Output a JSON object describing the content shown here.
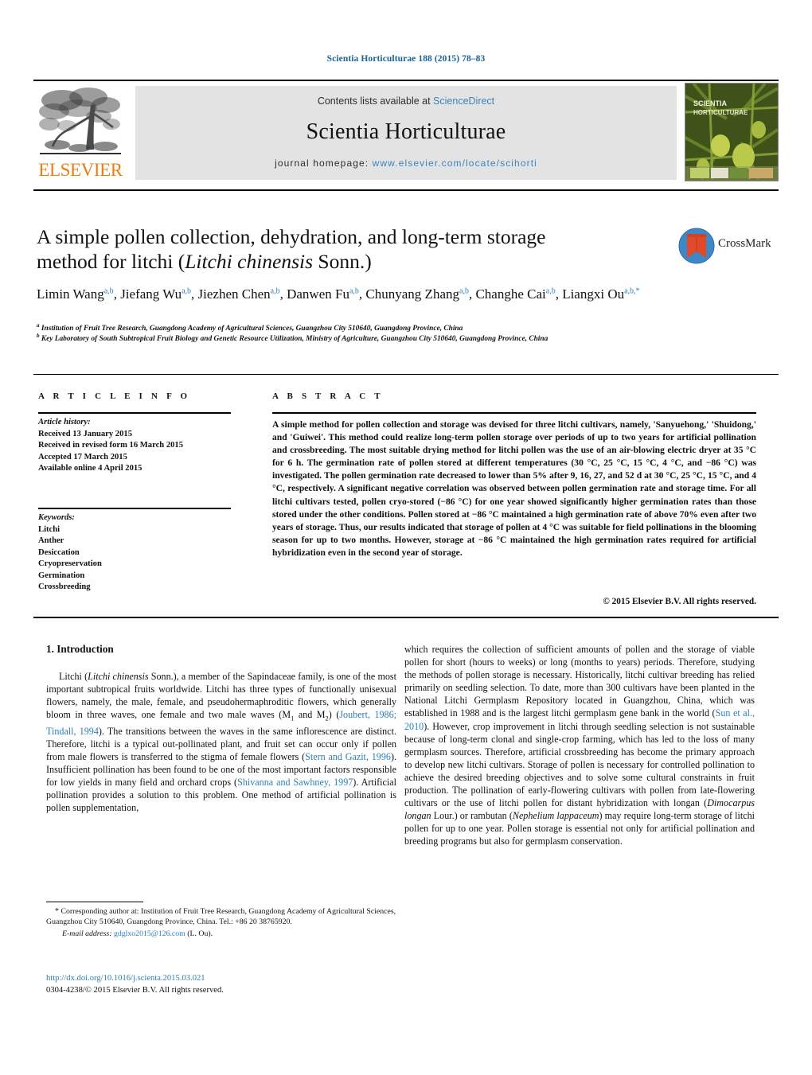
{
  "running_head": "Scientia Horticulturae 188 (2015) 78–83",
  "masthead": {
    "contents_prefix": "Contents lists available at ",
    "sciencedirect": "ScienceDirect",
    "journal_name": "Scientia Horticulturae",
    "homepage_prefix": "journal homepage: ",
    "homepage_url": "www.elsevier.com/locate/scihorti",
    "publisher_wordmark": "ELSEVIER",
    "cover_title_line1": "SCIENTIA",
    "cover_title_line2": "HORTICULTURAE",
    "accent_color": "#3a84bd",
    "elsevier_orange": "#ee7d11"
  },
  "crossmark": {
    "label": "CrossMark"
  },
  "article": {
    "title_line1": "A simple pollen collection, dehydration, and long-term storage",
    "title_line2_pre": "method for litchi (",
    "title_line2_italic": "Litchi chinensis",
    "title_line2_post": " Sonn.)",
    "authors": [
      {
        "name": "Limin Wang",
        "sup": "a,b",
        "sep": ", "
      },
      {
        "name": "Jiefang Wu",
        "sup": "a,b",
        "sep": ", "
      },
      {
        "name": "Jiezhen Chen",
        "sup": "a,b",
        "sep": ", "
      },
      {
        "name": "Danwen Fu",
        "sup": "a,b",
        "sep": ", "
      },
      {
        "name": "Chunyang Zhang",
        "sup": "a,b",
        "sep": ", "
      },
      {
        "name": "Changhe Cai",
        "sup": "a,b",
        "sep": ", "
      },
      {
        "name": "Liangxi Ou",
        "sup": "a,b,*",
        "sep": ""
      }
    ],
    "affiliations": [
      {
        "marker": "a",
        "text": "Institution of Fruit Tree Research, Guangdong Academy of Agricultural Sciences, Guangzhou City 510640, Guangdong Province, China"
      },
      {
        "marker": "b",
        "text": "Key Laboratory of South Subtropical Fruit Biology and Genetic Resource Utilization, Ministry of Agriculture, Guangzhou City 510640, Guangdong Province, China"
      }
    ]
  },
  "article_info": {
    "heading": "A R T I C L E   I N F O",
    "history_label": "Article history:",
    "history": [
      "Received 13 January 2015",
      "Received in revised form 16 March 2015",
      "Accepted 17 March 2015",
      "Available online 4 April 2015"
    ],
    "keywords_label": "Keywords:",
    "keywords": [
      "Litchi",
      "Anther",
      "Desiccation",
      "Cryopreservation",
      "Germination",
      "Crossbreeding"
    ]
  },
  "abstract": {
    "heading": "A B S T R A C T",
    "text": "A simple method for pollen collection and storage was devised for three litchi cultivars, namely, 'Sanyuehong,' 'Shuidong,' and 'Guiwei'. This method could realize long-term pollen storage over periods of up to two years for artificial pollination and crossbreeding. The most suitable drying method for litchi pollen was the use of an air-blowing electric dryer at 35 °C for 6 h. The germination rate of pollen stored at different temperatures (30 °C, 25 °C, 15 °C, 4 °C, and −86 °C) was investigated. The pollen germination rate decreased to lower than 5% after 9, 16, 27, and 52 d at 30 °C, 25 °C, 15 °C, and 4 °C, respectively. A significant negative correlation was observed between pollen germination rate and storage time. For all litchi cultivars tested, pollen cryo-stored (−86 °C) for one year showed significantly higher germination rates than those stored under the other conditions. Pollen stored at −86 °C maintained a high germination rate of above 70% even after two years of storage. Thus, our results indicated that storage of pollen at 4 °C was suitable for field pollinations in the blooming season for up to two months. However, storage at −86 °C maintained the high germination rates required for artificial hybridization even in the second year of storage.",
    "copyright": "© 2015 Elsevier B.V. All rights reserved."
  },
  "introduction": {
    "section_number_title": "1.  Introduction",
    "left_para_segments": [
      {
        "t": "Litchi (",
        "s": "plain"
      },
      {
        "t": "Litchi chinensis",
        "s": "italic"
      },
      {
        "t": " Sonn.), a member of the Sapindaceae family, is one of the most important subtropical fruits worldwide. Litchi has three types of functionally unisexual flowers, namely, the male, female, and pseudohermaphroditic flowers, which generally bloom in three waves, one female and two male waves (M",
        "s": "plain"
      },
      {
        "t": "1",
        "s": "sub"
      },
      {
        "t": " and M",
        "s": "plain"
      },
      {
        "t": "2",
        "s": "sub"
      },
      {
        "t": ") (",
        "s": "plain"
      },
      {
        "t": "Joubert, 1986; Tindall, 1994",
        "s": "ref"
      },
      {
        "t": "). The transitions between the waves in the same inflorescence are distinct. Therefore, litchi is a typical out-pollinated plant, and fruit set can occur only if pollen from male flowers is transferred to the stigma of female flowers (",
        "s": "plain"
      },
      {
        "t": "Stern and Gazit, 1996",
        "s": "ref"
      },
      {
        "t": "). Insufficient pollination has been found to be one of the most important factors responsible for low yields in many field and orchard crops (",
        "s": "plain"
      },
      {
        "t": "Shivanna and Sawhney, 1997",
        "s": "ref"
      },
      {
        "t": "). Artificial pollination provides a solution to this problem. One method of artificial pollination is pollen supplementation,",
        "s": "plain"
      }
    ],
    "right_para_segments": [
      {
        "t": "which requires the collection of sufficient amounts of pollen and the storage of viable pollen for short (hours to weeks) or long (months to years) periods. Therefore, studying the methods of pollen storage is necessary. Historically, litchi cultivar breeding has relied primarily on seedling selection. To date, more than 300 cultivars have been planted in the National Litchi Germplasm Repository located in Guangzhou, China, which was established in 1988 and is the largest litchi germplasm gene bank in the world (",
        "s": "plain"
      },
      {
        "t": "Sun et al., 2010",
        "s": "ref"
      },
      {
        "t": "). However, crop improvement in litchi through seedling selection is not sustainable because of long-term clonal and single-crop farming, which has led to the loss of many germplasm sources. Therefore, artificial crossbreeding has become the primary approach to develop new litchi cultivars. Storage of pollen is necessary for controlled pollination to achieve the desired breeding objectives and to solve some cultural constraints in fruit production. The pollination of early-flowering cultivars with pollen from late-flowering cultivars or the use of litchi pollen for distant hybridization with longan (",
        "s": "plain"
      },
      {
        "t": "Dimocarpus longan",
        "s": "italic"
      },
      {
        "t": " Lour.) or rambutan (",
        "s": "plain"
      },
      {
        "t": "Nephelium lappaceum",
        "s": "italic"
      },
      {
        "t": ") may require long-term storage of litchi pollen for up to one year. Pollen storage is essential not only for artificial pollination and breeding programs but also for germplasm conservation.",
        "s": "plain"
      }
    ]
  },
  "footnote": {
    "star": "*",
    "corresponding": " Corresponding author at: Institution of Fruit Tree Research, Guangdong Academy of Agricultural Sciences, Guangzhou City 510640, Guangdong Province, China. Tel.: +86 20 38765920.",
    "email_label": "E-mail address:",
    "email": "gdglxo2015@126.com",
    "email_owner": "(L. Ou)."
  },
  "footer": {
    "doi_url": "http://dx.doi.org/10.1016/j.scienta.2015.03.021",
    "issn_line": "0304-4238/© 2015 Elsevier B.V. All rights reserved."
  }
}
